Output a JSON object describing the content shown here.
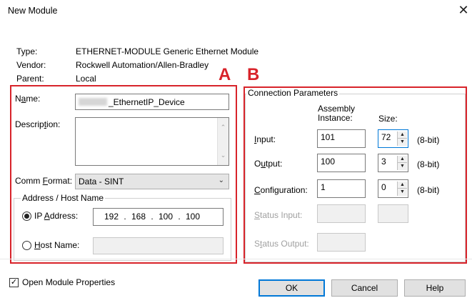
{
  "window": {
    "title": "New Module",
    "close_glyph": "✕"
  },
  "info": {
    "type_label": "Type:",
    "type_value": "ETHERNET-MODULE Generic Ethernet Module",
    "vendor_label": "Vendor:",
    "vendor_value": "Rockwell Automation/Allen-Bradley",
    "parent_label": "Parent:",
    "parent_value": "Local"
  },
  "annotations": {
    "a": "A",
    "b": "B",
    "accent_color": "#d8232a"
  },
  "left": {
    "name_label_pre": "N",
    "name_label_ul": "a",
    "name_label_post": "me:",
    "name_value": "_EthernetIP_Device",
    "description_label_pre": "Descrip",
    "description_label_ul": "t",
    "description_label_post": "ion:",
    "description_value": "",
    "comm_format_label_pre": "Comm ",
    "comm_format_label_ul": "F",
    "comm_format_label_post": "ormat:",
    "comm_format_value": "Data - SINT",
    "address_group_title": "Address / Host Name",
    "ip_label_pre": "IP ",
    "ip_label_ul": "A",
    "ip_label_post": "ddress:",
    "ip_octets": [
      "192",
      "168",
      "100",
      "100"
    ],
    "ip_selected": true,
    "host_label_pre": "",
    "host_label_ul": "H",
    "host_label_post": "ost Name:",
    "host_value": ""
  },
  "connection": {
    "title": "Connection Parameters",
    "col_assembly": "Assembly\nInstance:",
    "col_size": "Size:",
    "rows": [
      {
        "label_pre": "",
        "label_ul": "I",
        "label_post": "nput:",
        "instance": "101",
        "size": "72",
        "unit": "(8-bit)",
        "enabled": true
      },
      {
        "label_pre": "O",
        "label_ul": "u",
        "label_post": "tput:",
        "instance": "100",
        "size": "3",
        "unit": "(8-bit)",
        "enabled": true
      },
      {
        "label_pre": "",
        "label_ul": "C",
        "label_post": "onfiguration:",
        "instance": "1",
        "size": "0",
        "unit": "(8-bit)",
        "enabled": true
      },
      {
        "label_pre": "",
        "label_ul": "S",
        "label_post": "tatus Input:",
        "instance": "",
        "size": "",
        "unit": "",
        "enabled": false
      },
      {
        "label_pre": "S",
        "label_ul": "t",
        "label_post": "atus Output:",
        "instance": "",
        "size": "",
        "unit": "",
        "enabled": false
      }
    ]
  },
  "footer": {
    "open_props_label": "Open Module Properties",
    "open_props_checked": true,
    "ok": "OK",
    "cancel": "Cancel",
    "help": "Help"
  }
}
